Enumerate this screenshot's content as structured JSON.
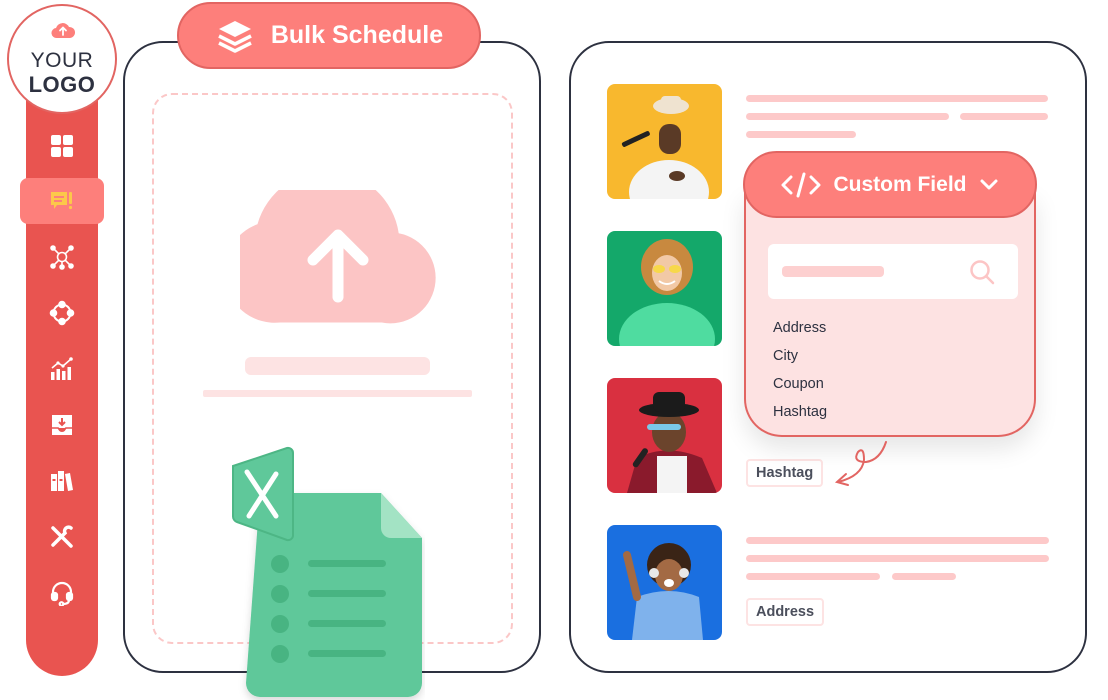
{
  "logo": {
    "line1": "YOUR",
    "line2": "LOGO",
    "icon": "cloud-upload-icon"
  },
  "sidebar": {
    "accent": "#e95450",
    "active_bg": "#fd7f7b",
    "items": [
      {
        "icon": "dashboard-grid-icon",
        "active": false
      },
      {
        "icon": "chat-alert-icon",
        "active": true
      },
      {
        "icon": "network-hub-icon",
        "active": false
      },
      {
        "icon": "connected-nodes-icon",
        "active": false
      },
      {
        "icon": "analytics-chart-icon",
        "active": false
      },
      {
        "icon": "inbox-download-icon",
        "active": false
      },
      {
        "icon": "library-books-icon",
        "active": false
      },
      {
        "icon": "tools-icon",
        "active": false
      },
      {
        "icon": "headset-support-icon",
        "active": false
      }
    ]
  },
  "bulk_schedule": {
    "title": "Bulk Schedule",
    "icon": "layers-icon",
    "upload_icon": "cloud-upload-icon",
    "file_icon": "excel-file-icon"
  },
  "posts": [
    {
      "avatar": "singer-hat-photo",
      "bg": "#f8b82e"
    },
    {
      "avatar": "woman-sunglasses-photo",
      "bg": "#14a86a"
    },
    {
      "avatar": "man-black-hat-photo",
      "bg": "#d93040"
    },
    {
      "avatar": "woman-headphones-photo",
      "bg": "#1a6fe0",
      "tag": "Address"
    }
  ],
  "custom_field": {
    "label": "Custom Field",
    "icon": "code-icon",
    "chevron": "chevron-down-icon",
    "search_icon": "search-icon",
    "options": [
      "Address",
      "City",
      "Coupon",
      "Hashtag"
    ],
    "inserted_tag": "Hashtag"
  },
  "colors": {
    "primary": "#fd7f7b",
    "primary_border": "#e26562",
    "light": "#fde2e2",
    "placeholder_line": "#fdc9c9",
    "excel_green": "#5fc89a",
    "outline": "#2d3140"
  }
}
